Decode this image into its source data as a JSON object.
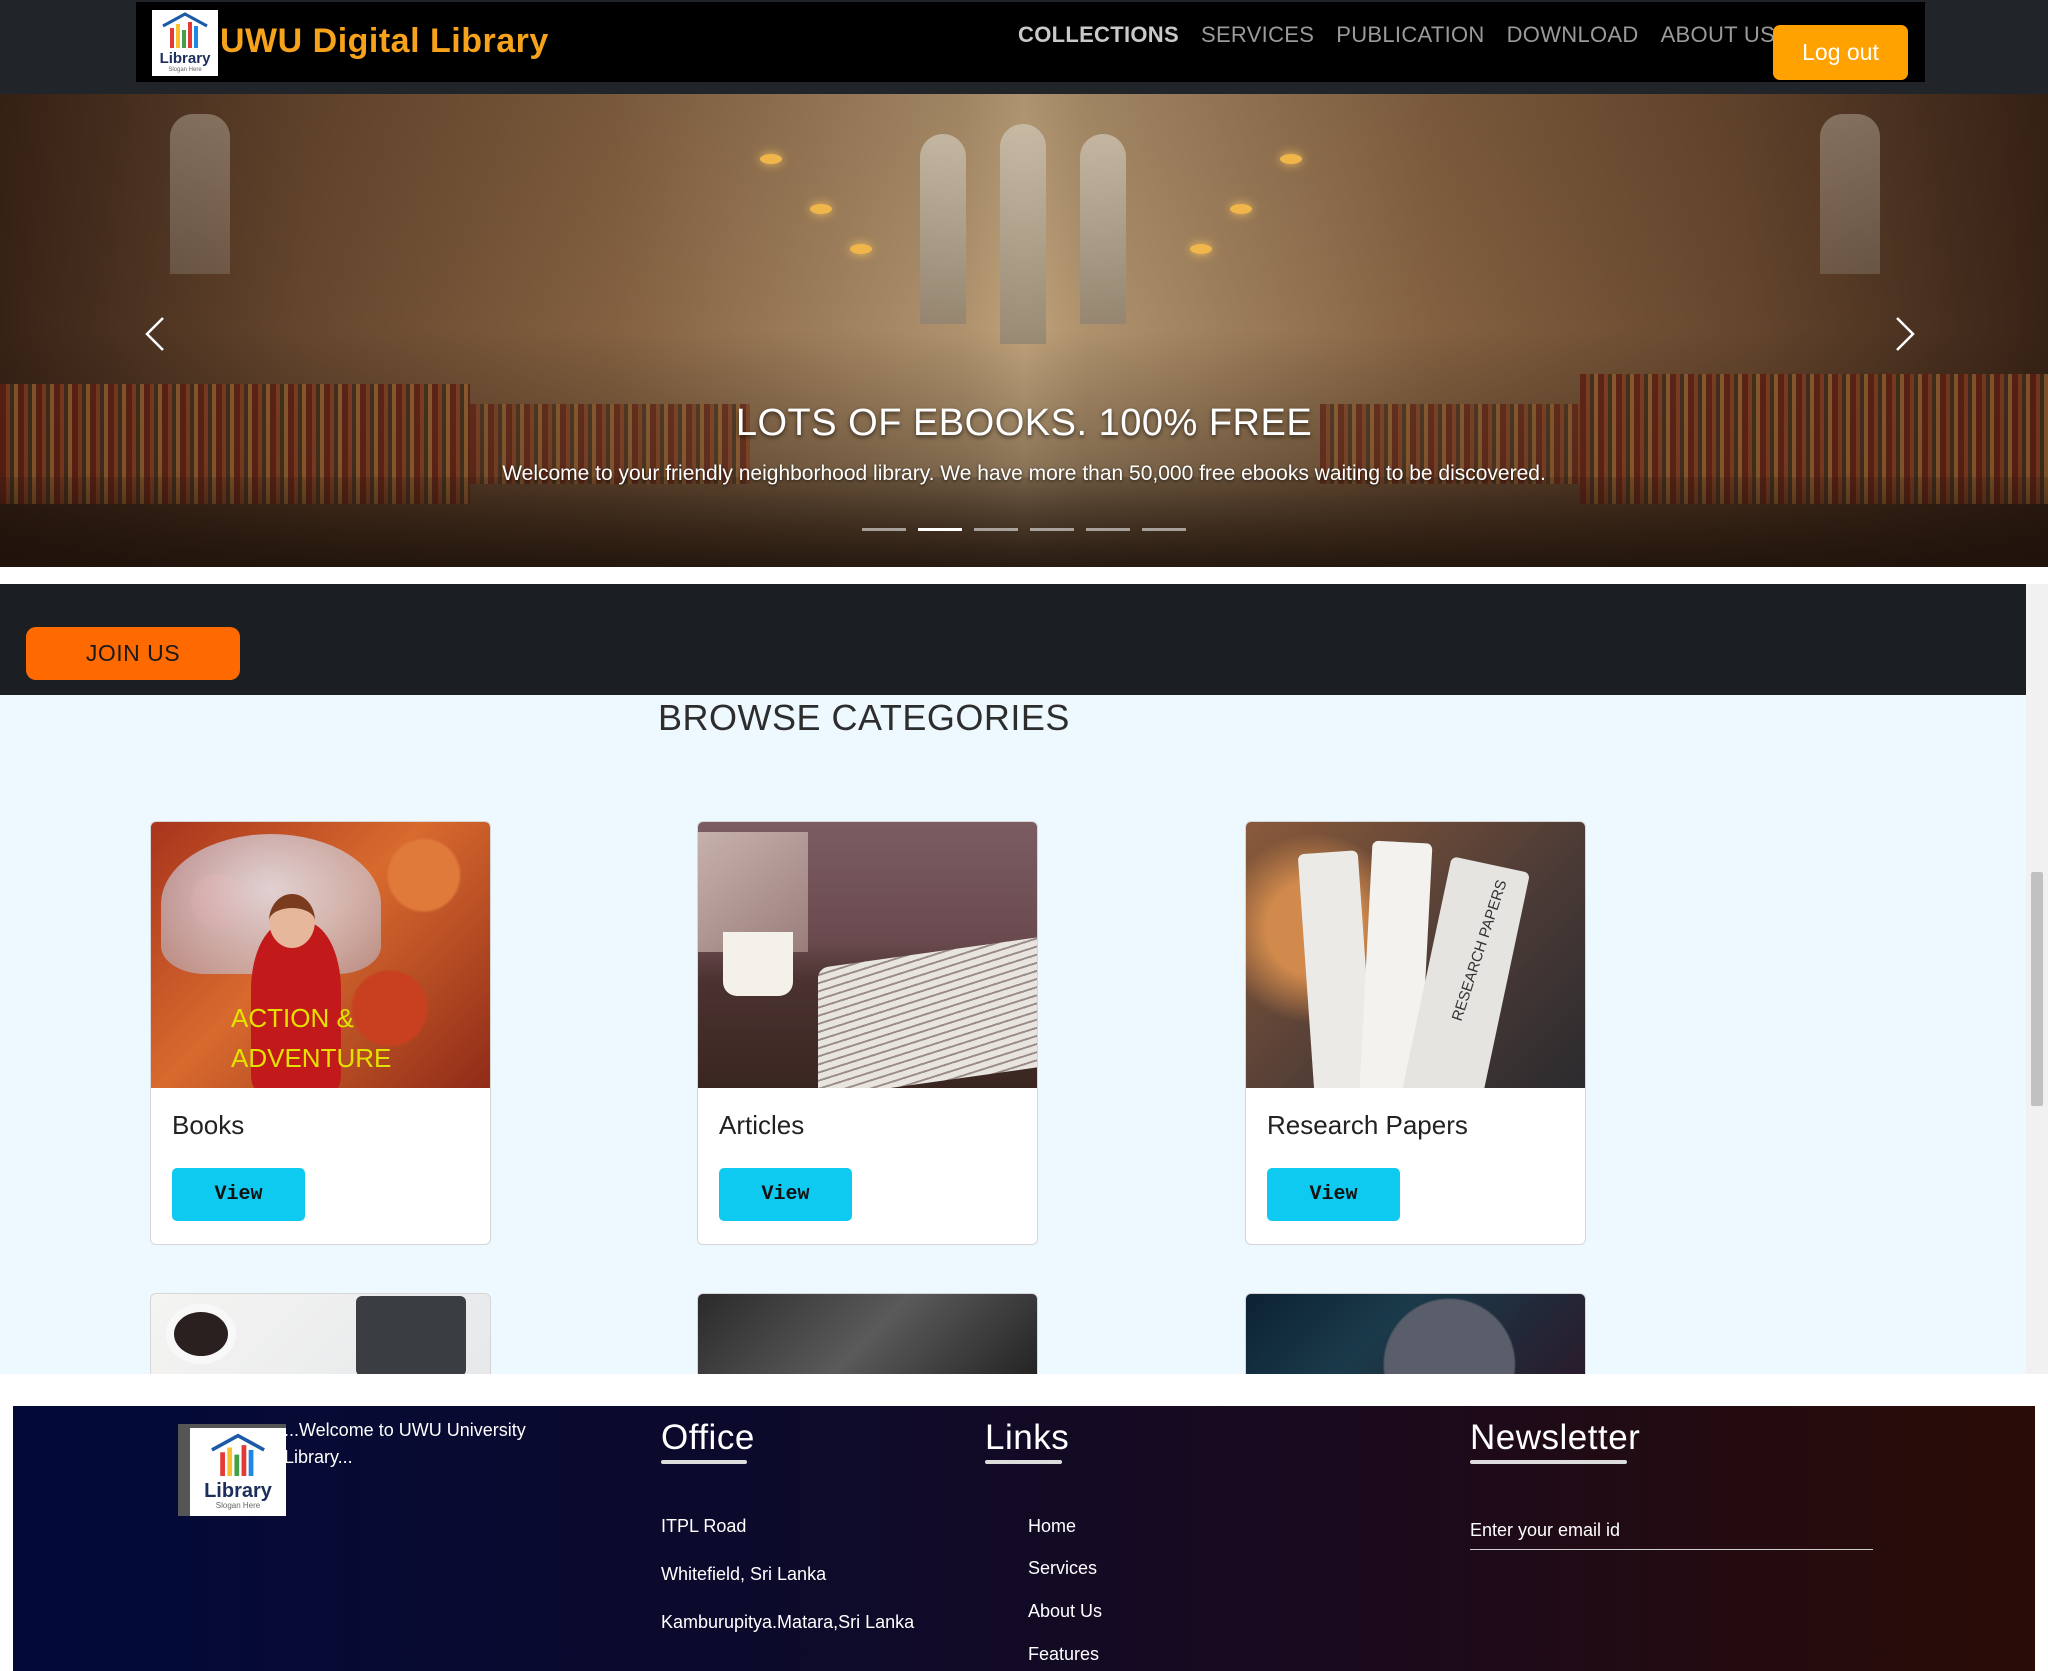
{
  "navbar": {
    "logo_text": "Library",
    "logo_slogan": "Slogan Here",
    "brand_title": "UWU Digital Library",
    "links": [
      "COLLECTIONS",
      "SERVICES",
      "PUBLICATION",
      "DOWNLOAD",
      "ABOUT US"
    ],
    "logout_label": "Log out"
  },
  "hero": {
    "title": "LOTS OF EBOOKS. 100% FREE",
    "subtitle": "Welcome to your friendly neighborhood library. We have more than 50,000 free ebooks waiting to be discovered.",
    "slide_count": 6,
    "active_slide": 1
  },
  "join": {
    "label": "JOIN US"
  },
  "categories": {
    "title": "BROWSE CATEGORIES",
    "cards": [
      {
        "label": "Books",
        "image_caption": "ACTION & ADVENTURE",
        "button": "View"
      },
      {
        "label": "Articles",
        "button": "View"
      },
      {
        "label": "Research Papers",
        "image_caption": "RESEARCH PAPERS",
        "button": "View"
      }
    ]
  },
  "footer": {
    "logo_text": "Library",
    "logo_slogan": "Slogan Here",
    "welcome": "...Welcome to UWU University Library...",
    "office": {
      "heading": "Office",
      "lines": [
        "ITPL Road",
        "Whitefield, Sri Lanka",
        "Kamburupitya.Matara,Sri Lanka"
      ]
    },
    "links": {
      "heading": "Links",
      "items": [
        "Home",
        "Services",
        "About Us",
        "Features"
      ]
    },
    "newsletter": {
      "heading": "Newsletter",
      "placeholder": "Enter your email id"
    }
  },
  "colors": {
    "brand_orange": "#f7a21b",
    "logout_bg": "#ffa200",
    "join_bg": "#ff6a00",
    "view_btn_bg": "#0fcaf0",
    "category_bg": "#eef8ff"
  }
}
